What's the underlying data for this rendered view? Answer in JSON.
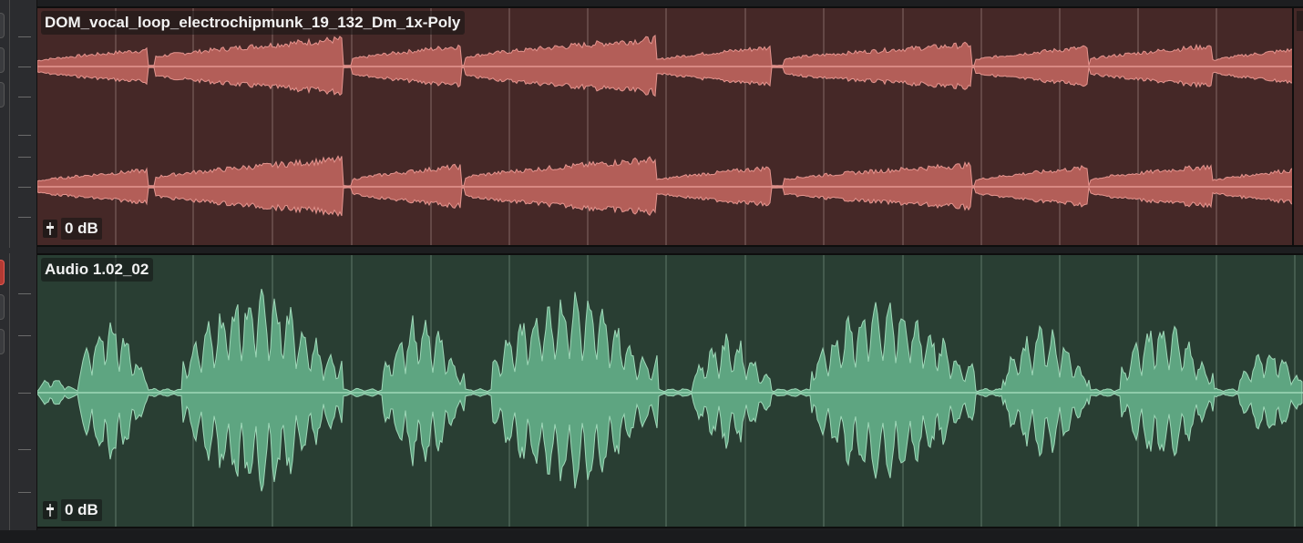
{
  "tracks": [
    {
      "clip_name": "DOM_vocal_loop_electrochipmunk_19_132_Dm_1x-Poly",
      "gain": "0 dB",
      "channels": 2,
      "colors": {
        "background": "#452827",
        "waveform": "#b35e58",
        "waveform_edge": "#e4958f",
        "gridline": "#6e5250"
      },
      "record_armed": false
    },
    {
      "clip_name": "Audio 1.02_02",
      "gain": "0 dB",
      "channels": 1,
      "colors": {
        "background": "#293e33",
        "waveform": "#5ea581",
        "waveform_edge": "#9fd8b8",
        "gridline": "#4d6558"
      },
      "record_armed": true
    }
  ],
  "icons": {
    "clip_gain": "clip-gain-fader-icon"
  }
}
